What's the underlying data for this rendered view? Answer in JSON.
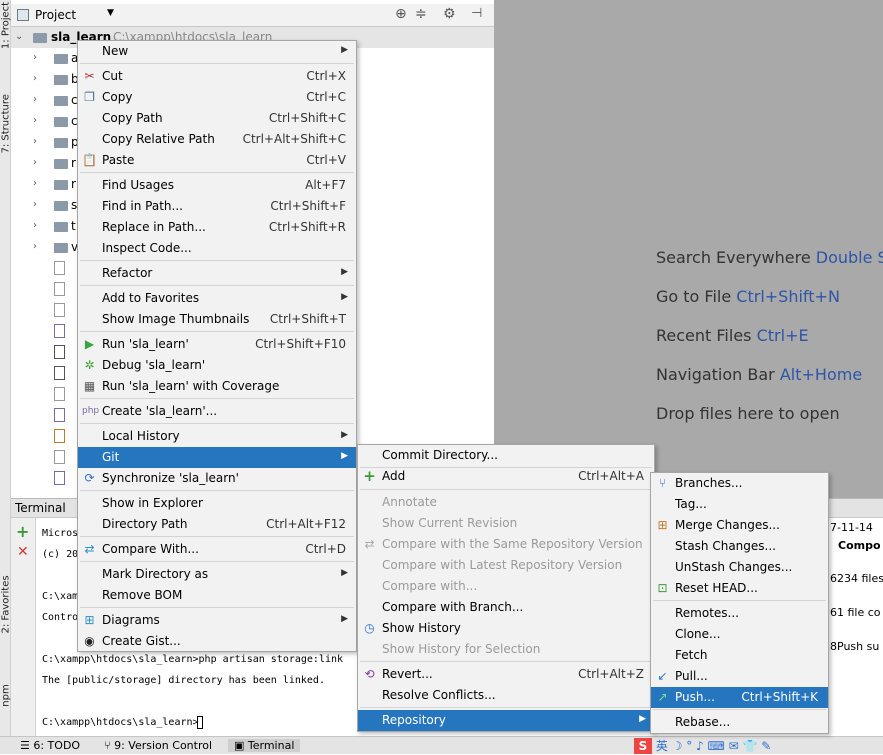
{
  "project_panel": {
    "header_label": "Project",
    "root_name": "sla_learn",
    "root_path": "C:\\xampp\\htdocs\\sla_learn",
    "tree_items": [
      "a",
      "b",
      "c",
      "c",
      "p",
      "r",
      "r",
      "s",
      "t",
      "v"
    ]
  },
  "left_stripe": {
    "project": "1: Project",
    "structure": "7: Structure",
    "favorites": "2: Favorites",
    "npm": "npm"
  },
  "editor_hints": [
    {
      "text": "Search Everywhere",
      "shortcut": "Double Shift"
    },
    {
      "text": "Go to File",
      "shortcut": "Ctrl+Shift+N"
    },
    {
      "text": "Recent Files",
      "shortcut": "Ctrl+E"
    },
    {
      "text": "Navigation Bar",
      "shortcut": "Alt+Home"
    },
    {
      "text": "Drop files here to open",
      "shortcut": ""
    }
  ],
  "terminal": {
    "title": "Terminal",
    "lines": [
      "Micros",
      "(c) 20",
      "",
      "C:\\xamp",
      "Contro",
      "",
      "C:\\xampp\\htdocs\\sla_learn>php artisan storage:link",
      "The [public/storage] directory has been linked.",
      "",
      "C:\\xampp\\htdocs\\sla_learn>"
    ]
  },
  "right_log": {
    "date": "7-11-14",
    "header": "Compo",
    "line1": "6234 files",
    "line2": "61 file co",
    "line3": "8Push su"
  },
  "bottom_bar": {
    "todo": "6: TODO",
    "vcs": "9: Version Control",
    "terminal": "Terminal"
  },
  "context_menu": {
    "items": [
      {
        "label": "New",
        "shortcut": "",
        "submenu": true
      },
      {
        "label": "Cut",
        "shortcut": "Ctrl+X"
      },
      {
        "label": "Copy",
        "shortcut": "Ctrl+C"
      },
      {
        "label": "Copy Path",
        "shortcut": "Ctrl+Shift+C"
      },
      {
        "label": "Copy Relative Path",
        "shortcut": "Ctrl+Alt+Shift+C"
      },
      {
        "label": "Paste",
        "shortcut": "Ctrl+V"
      },
      {
        "label": "Find Usages",
        "shortcut": "Alt+F7"
      },
      {
        "label": "Find in Path...",
        "shortcut": "Ctrl+Shift+F"
      },
      {
        "label": "Replace in Path...",
        "shortcut": "Ctrl+Shift+R"
      },
      {
        "label": "Inspect Code...",
        "shortcut": ""
      },
      {
        "label": "Refactor",
        "shortcut": "",
        "submenu": true
      },
      {
        "label": "Add to Favorites",
        "shortcut": "",
        "submenu": true
      },
      {
        "label": "Show Image Thumbnails",
        "shortcut": "Ctrl+Shift+T"
      },
      {
        "label": "Run 'sla_learn'",
        "shortcut": "Ctrl+Shift+F10"
      },
      {
        "label": "Debug 'sla_learn'",
        "shortcut": ""
      },
      {
        "label": "Run 'sla_learn' with Coverage",
        "shortcut": ""
      },
      {
        "label": "Create 'sla_learn'...",
        "shortcut": ""
      },
      {
        "label": "Local History",
        "shortcut": "",
        "submenu": true
      },
      {
        "label": "Git",
        "shortcut": "",
        "submenu": true
      },
      {
        "label": "Synchronize 'sla_learn'",
        "shortcut": ""
      },
      {
        "label": "Show in Explorer",
        "shortcut": ""
      },
      {
        "label": "Directory Path",
        "shortcut": "Ctrl+Alt+F12"
      },
      {
        "label": "Compare With...",
        "shortcut": "Ctrl+D"
      },
      {
        "label": "Mark Directory as",
        "shortcut": "",
        "submenu": true
      },
      {
        "label": "Remove BOM",
        "shortcut": ""
      },
      {
        "label": "Diagrams",
        "shortcut": "",
        "submenu": true
      },
      {
        "label": "Create Gist...",
        "shortcut": ""
      }
    ]
  },
  "git_menu": {
    "items": [
      {
        "label": "Commit Directory...",
        "shortcut": ""
      },
      {
        "label": "Add",
        "shortcut": "Ctrl+Alt+A"
      },
      {
        "label": "Annotate",
        "shortcut": ""
      },
      {
        "label": "Show Current Revision",
        "shortcut": ""
      },
      {
        "label": "Compare with the Same Repository Version",
        "shortcut": ""
      },
      {
        "label": "Compare with Latest Repository Version",
        "shortcut": ""
      },
      {
        "label": "Compare with...",
        "shortcut": ""
      },
      {
        "label": "Compare with Branch...",
        "shortcut": ""
      },
      {
        "label": "Show History",
        "shortcut": ""
      },
      {
        "label": "Show History for Selection",
        "shortcut": ""
      },
      {
        "label": "Revert...",
        "shortcut": "Ctrl+Alt+Z"
      },
      {
        "label": "Resolve Conflicts...",
        "shortcut": ""
      },
      {
        "label": "Repository",
        "shortcut": "",
        "submenu": true
      }
    ]
  },
  "repo_menu": {
    "items": [
      {
        "label": "Branches...",
        "shortcut": ""
      },
      {
        "label": "Tag...",
        "shortcut": ""
      },
      {
        "label": "Merge Changes...",
        "shortcut": ""
      },
      {
        "label": "Stash Changes...",
        "shortcut": ""
      },
      {
        "label": "UnStash Changes...",
        "shortcut": ""
      },
      {
        "label": "Reset HEAD...",
        "shortcut": ""
      },
      {
        "label": "Remotes...",
        "shortcut": ""
      },
      {
        "label": "Clone...",
        "shortcut": ""
      },
      {
        "label": "Fetch",
        "shortcut": ""
      },
      {
        "label": "Pull...",
        "shortcut": ""
      },
      {
        "label": "Push...",
        "shortcut": "Ctrl+Shift+K"
      },
      {
        "label": "Rebase...",
        "shortcut": ""
      }
    ]
  },
  "colors": {
    "selection": "#2675bf",
    "editor_bg": "#a9a9a9",
    "menu_bg": "#f2f2f2",
    "shortcut_blue": "#2d55a8"
  }
}
